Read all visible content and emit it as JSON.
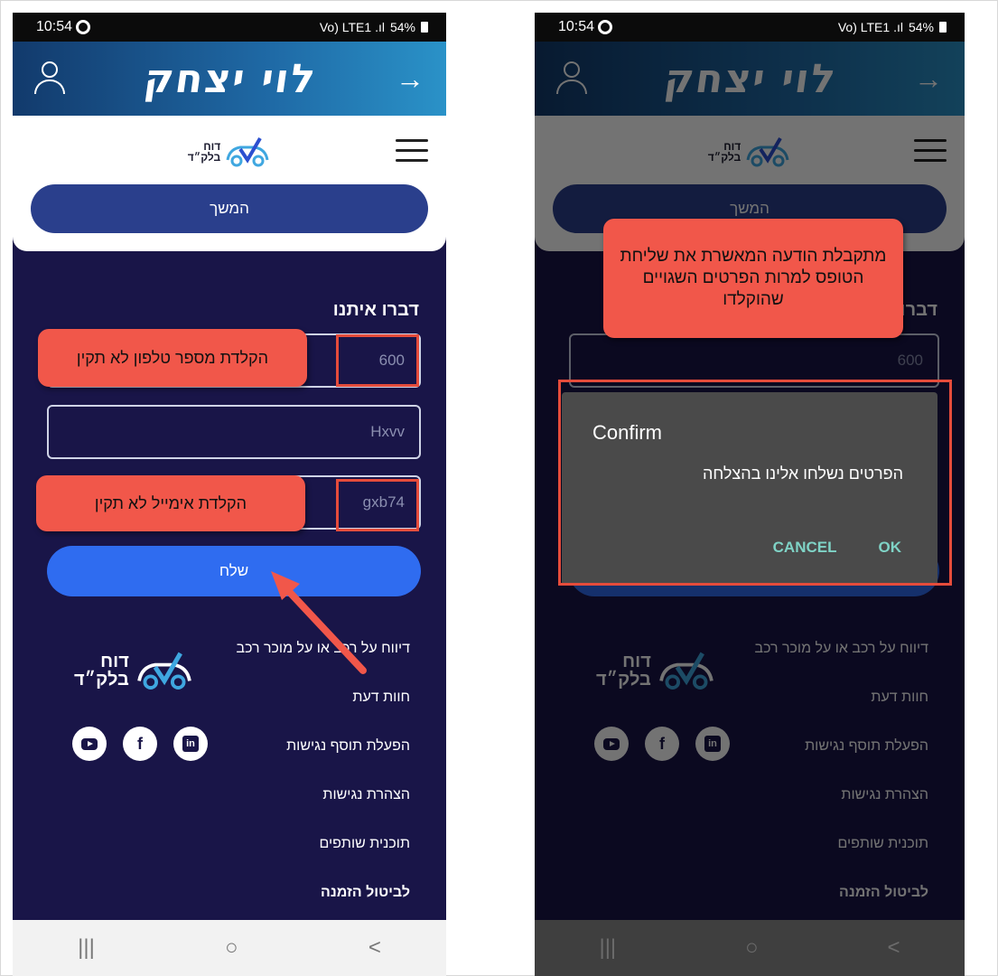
{
  "status_bar": {
    "time": "10:54",
    "signal": "Vo) LTE1 .ıl",
    "battery": "54%"
  },
  "app_bar": {
    "brand": "לוי יצחק",
    "back_arrow": "→",
    "user_icon": "user-icon"
  },
  "site_logo": {
    "line1": "דוח",
    "line2": "בלק״ד"
  },
  "continue_button": "המשך",
  "contact_form": {
    "title": "דברו איתנו",
    "phone_value": "600",
    "name_value": "Hxvv",
    "email_value": "gxb74",
    "send_button": "שלח"
  },
  "annotations": {
    "invalid_phone": "הקלדת מספר טלפון לא תקין",
    "invalid_email": "הקלדת אימייל לא תקין",
    "result_note": "מתקבלת הודעה המאשרת את שליחת הטופס למרות הפרטים השגויים שהוקלדו",
    "accent_color": "#f1574a"
  },
  "footer_links": [
    "דיווח על רכב או על מוכר רכב",
    "חוות דעת",
    "הפעלת תוסף נגישות",
    "הצהרת נגישות",
    "תוכנית שותפים",
    "לביטול הזמנה"
  ],
  "socials": [
    "youtube-icon",
    "facebook-icon",
    "linkedin-icon"
  ],
  "nav_bar": {
    "recents": "|||",
    "home": "○",
    "back": "<"
  },
  "dialog": {
    "title": "Confirm",
    "message": "הפרטים נשלחו אלינו בהצלחה",
    "cancel": "CANCEL",
    "ok": "OK"
  },
  "colors": {
    "page_bg": "#191548",
    "app_bar": "#1f6aa6",
    "send_button": "#2f6cf0",
    "continue_button": "#2a3f8c"
  }
}
